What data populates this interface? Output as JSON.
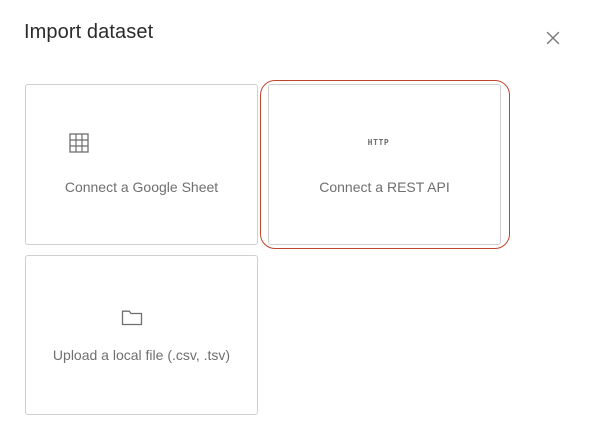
{
  "dialog": {
    "title": "Import dataset",
    "close_icon": "close-icon"
  },
  "options": [
    {
      "id": "google-sheet",
      "icon": "grid-table-icon",
      "label": "Connect a Google Sheet"
    },
    {
      "id": "rest-api",
      "icon": "http-icon",
      "icon_text": "HTTP",
      "label": "Connect a REST API",
      "focused": true
    },
    {
      "id": "local-file",
      "icon": "folder-icon",
      "label": "Upload a local file (.csv, .tsv)"
    }
  ],
  "colors": {
    "focus_ring": "#c0452c",
    "card_border": "#cfcfcf",
    "label_text": "#6f6f6f",
    "title_text": "#2b2b2b"
  }
}
